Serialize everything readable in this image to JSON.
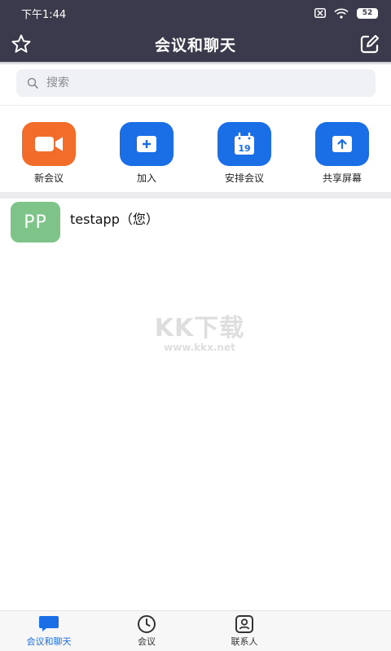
{
  "status_bar": {
    "time": "下午1:44",
    "battery": "52"
  },
  "header": {
    "title": "会议和聊天"
  },
  "search": {
    "placeholder": "搜索"
  },
  "actions": [
    {
      "label": "新会议",
      "icon": "video-camera-icon",
      "color": "#f26d2a"
    },
    {
      "label": "加入",
      "icon": "plus-icon",
      "color": "#1a6ee6"
    },
    {
      "label": "安排会议",
      "icon": "calendar-icon",
      "color": "#1a6ee6",
      "calendar_day": "19"
    },
    {
      "label": "共享屏幕",
      "icon": "share-screen-icon",
      "color": "#1a6ee6"
    }
  ],
  "contacts": [
    {
      "initials": "PP",
      "name": "testapp（您）"
    }
  ],
  "watermark": {
    "logo": "KK下载",
    "url": "www.kkx.net"
  },
  "tabs": [
    {
      "label": "会议和聊天",
      "icon": "chat-bubble-icon",
      "active": true
    },
    {
      "label": "会议",
      "icon": "clock-icon",
      "active": false
    },
    {
      "label": "联系人",
      "icon": "contact-card-icon",
      "active": false
    }
  ],
  "colors": {
    "header_bg": "#3b3a4c",
    "accent": "#1a6ee6",
    "avatar_bg": "#7ec387"
  }
}
